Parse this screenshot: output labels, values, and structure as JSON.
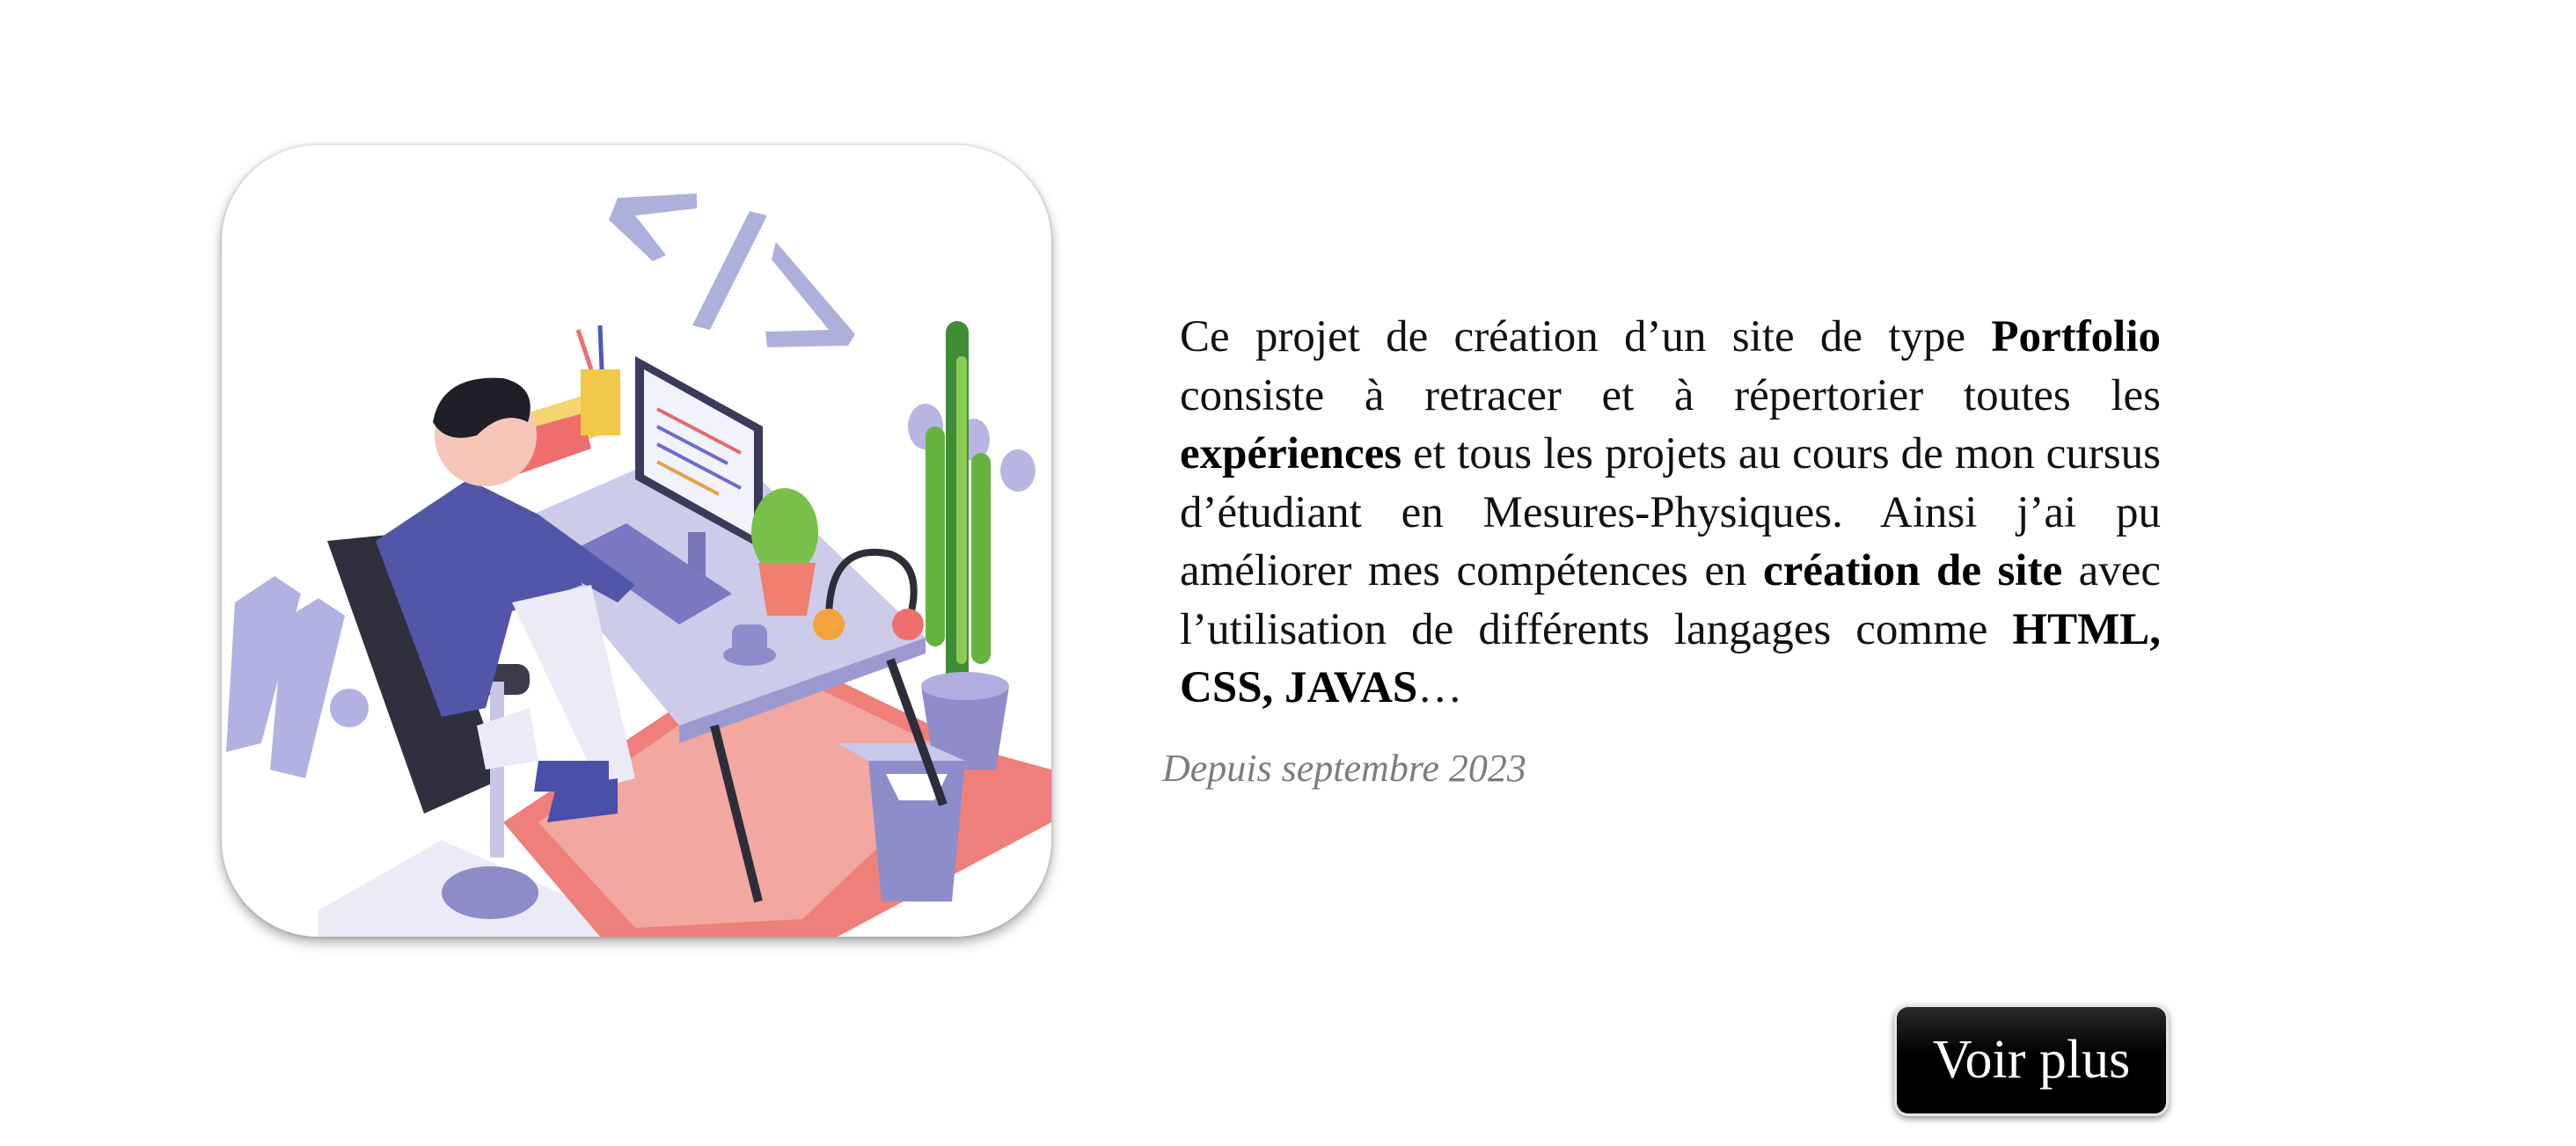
{
  "illustration": {
    "icon": "developer-at-desk-illustration"
  },
  "description": {
    "seg1": "Ce projet de création d’un site de type ",
    "bold1": "Portfolio",
    "seg2": " consiste à retracer et à répertorier toutes les ",
    "bold2": "expériences",
    "seg3": " et tous les projets au cours de mon cursus d’étudiant en Mesures-Physiques. Ainsi j’ai pu améliorer mes compétences en ",
    "bold3": "création de site",
    "seg4": " avec l’utilisation de différents langages comme ",
    "bold4": "HTML, CSS, JAVAS",
    "seg5": "…"
  },
  "date": "Depuis septembre 2023",
  "button": {
    "label": "Voir plus"
  },
  "colors": {
    "accent": "#a9a8dc",
    "button_bg": "#000000",
    "date_text": "#7d7d7d"
  }
}
